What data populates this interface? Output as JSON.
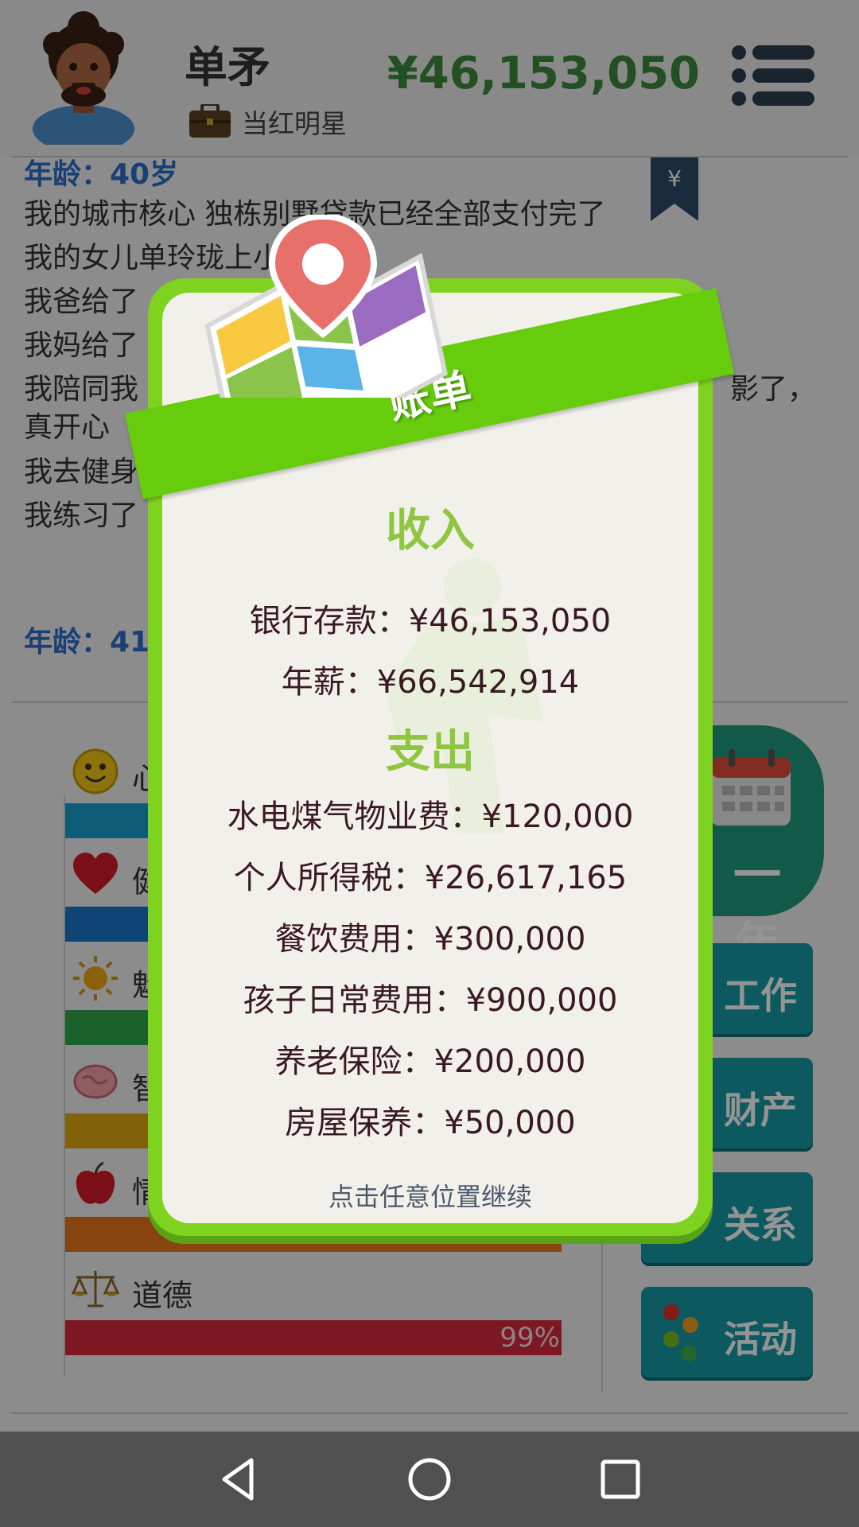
{
  "header": {
    "player_name": "单矛",
    "job_title": "当红明星",
    "money": "¥46,153,050",
    "avatar_icon": "man-avatar-icon",
    "job_icon": "briefcase-icon",
    "menu_icon": "menu-list-icon"
  },
  "log": {
    "age_previous": "年龄：40岁",
    "entries": [
      "我的城市核心 独栋别墅贷款已经全部支付完了",
      "我的女儿单玲珑上小学了",
      "我爸给了",
      "我妈给了",
      "我陪同我",
      "真开心",
      "我去健身",
      "我练习了"
    ],
    "entry_tail": "影了，",
    "age_current": "年龄：41"
  },
  "stats": [
    {
      "icon": "smile-icon",
      "label": "心",
      "color": "#1b9fd0",
      "value": 0.99
    },
    {
      "icon": "heart-icon",
      "label": "健",
      "color": "#1a77c9",
      "value": 0.99
    },
    {
      "icon": "sun-icon",
      "label": "魅",
      "color": "#2da84a",
      "value": 0.99
    },
    {
      "icon": "brain-icon",
      "label": "智",
      "color": "#e0a814",
      "value": 0.99
    },
    {
      "icon": "apple-icon",
      "label": "情",
      "color": "#e8761a",
      "value": 0.99,
      "pct": "99%"
    },
    {
      "icon": "scales-icon",
      "label": "道德",
      "color": "#d62a3a",
      "value": 0.99,
      "pct": "99%"
    }
  ],
  "actions": {
    "year_label": "一年",
    "work_label": "工作",
    "assets_label": "财产",
    "relations_label": "关系",
    "activities_label": "活动"
  },
  "dialog": {
    "title": "账单",
    "income_title": "收入",
    "bank_deposit": "银行存款：¥46,153,050",
    "salary": "年薪：¥66,542,914",
    "expense_title": "支出",
    "utilities": "水电煤气物业费：¥120,000",
    "income_tax": "个人所得税：¥26,617,165",
    "dining": "餐饮费用：¥300,000",
    "child_expenses": "孩子日常费用：¥900,000",
    "pension": "养老保险：¥200,000",
    "maintenance": "房屋保养：¥50,000",
    "continue_hint": "点击任意位置继续"
  },
  "colors": {
    "dialog_border": "#7ed321",
    "banner": "#66cc0c",
    "section_title": "#8ec63f",
    "money": "#3c8a3c"
  }
}
